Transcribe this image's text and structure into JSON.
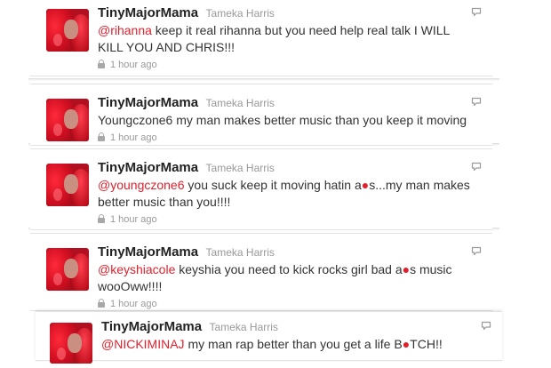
{
  "tweets": [
    {
      "username": "TinyMajorMama",
      "realname": "Tameka Harris",
      "body": [
        {
          "text": "@rihanna",
          "mention": true
        },
        {
          "text": " keep it real rihanna but you need help real talk I WILL KILL YOU AND CHRIS!!!"
        }
      ],
      "time": "1 hour ago",
      "icon": "lock-icon"
    },
    {
      "username": "TinyMajorMama",
      "realname": "Tameka Harris",
      "body": [
        {
          "text": "Youngczone6 my man makes better music than you keep it moving"
        }
      ],
      "time": "1 hour ago",
      "icon": "lock-icon"
    },
    {
      "username": "TinyMajorMama",
      "realname": "Tameka Harris",
      "body": [
        {
          "text": "@youngczone6",
          "mention": true
        },
        {
          "text": " you suck keep it moving hatin a"
        },
        {
          "text": "●",
          "blot": true
        },
        {
          "text": "s...my man makes better music than you!!!!"
        }
      ],
      "time": "1 hour ago",
      "icon": "lock-icon"
    },
    {
      "username": "TinyMajorMama",
      "realname": "Tameka Harris",
      "body": [
        {
          "text": "@keyshiacole",
          "mention": true
        },
        {
          "text": " keyshia you need to kick rocks girl bad a"
        },
        {
          "text": "●",
          "blot": true
        },
        {
          "text": "s music wooOww!!!!"
        }
      ],
      "time": "1 hour ago",
      "icon": "lock-icon"
    },
    {
      "username": "TinyMajorMama",
      "realname": "Tameka Harris",
      "body": [
        {
          "text": "@NICKIMINAJ",
          "mention": true
        },
        {
          "text": " my man rap better than you get a life B"
        },
        {
          "text": "●",
          "blot": true
        },
        {
          "text": "TCH!!"
        }
      ],
      "time": "",
      "icon": "lock-icon"
    }
  ],
  "colors": {
    "mention": "#e0202d",
    "username": "#222222",
    "meta": "#999999",
    "reply_icon": "#9a9a9a"
  },
  "icons": {
    "reply": "reply-icon",
    "avatar": "avatar",
    "lock": "lock-icon"
  }
}
